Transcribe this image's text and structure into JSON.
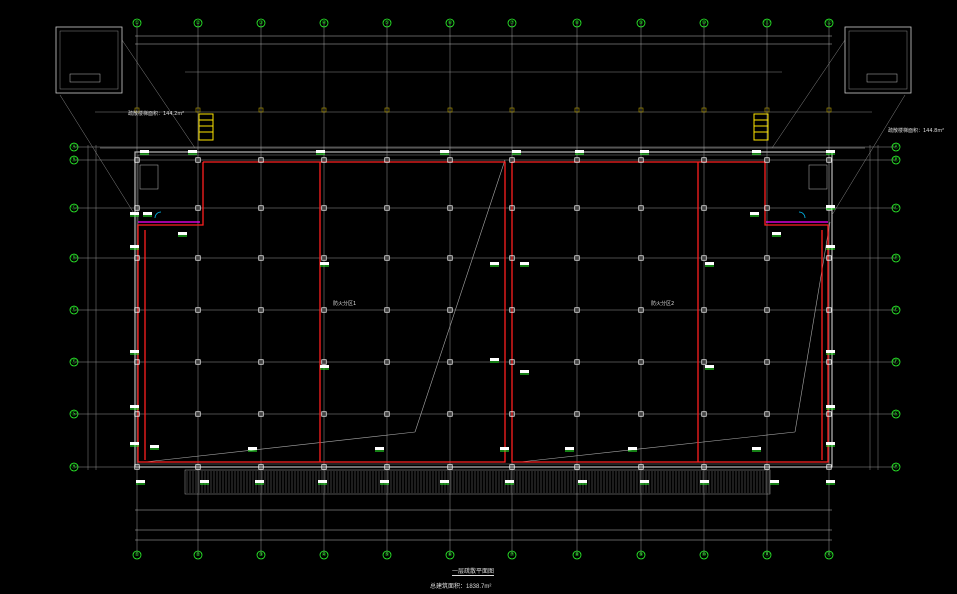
{
  "drawing": {
    "colors": {
      "background": "#000000",
      "grid_line": "#c8c8c8",
      "axis_bubble": "#2dff2d",
      "fire_boundary": "#ff2020",
      "column": "#ffffff",
      "stair": "#ffe600",
      "accent_magenta": "#ff00ff",
      "accent_cyan": "#00c8ff"
    },
    "top_axes": [
      "①",
      "②",
      "③",
      "④",
      "⑤",
      "⑥",
      "⑦",
      "⑧",
      "⑨",
      "⑩",
      "⑪",
      "⑫"
    ],
    "left_axes": [
      "Ⓐ",
      "Ⓑ",
      "Ⓒ",
      "Ⓓ",
      "Ⓔ",
      "Ⓕ",
      "Ⓖ",
      "Ⓗ"
    ],
    "room_left": "防火分区1",
    "room_right": "防火分区2",
    "stair_left_area": "疏散楼梯面积：144.2m²",
    "stair_right_area": "疏散楼梯面积：144.8m²",
    "plan_title": "一层疏散平面图",
    "plan_area": "总建筑面积：1838.7m²"
  }
}
